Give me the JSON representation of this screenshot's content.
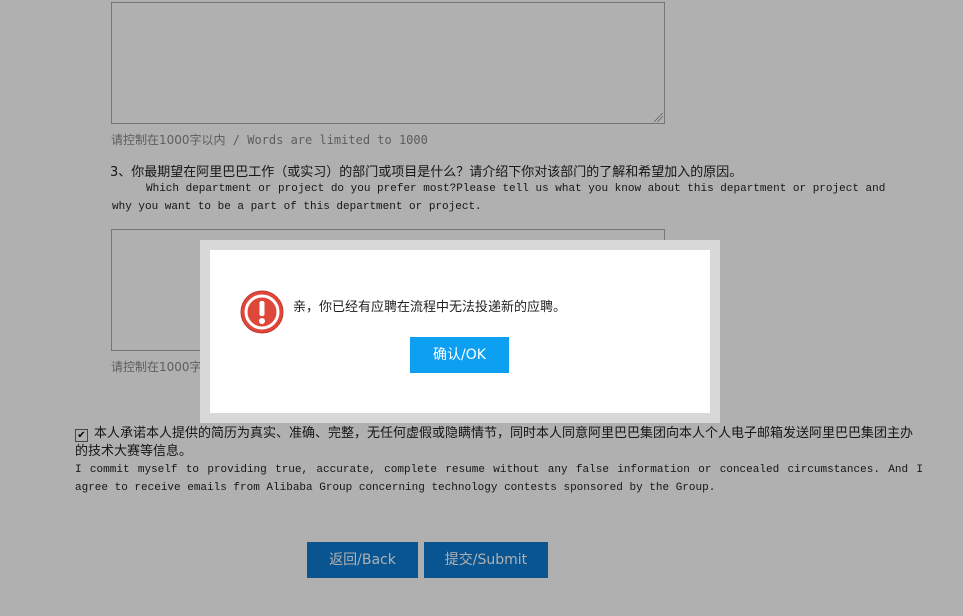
{
  "form": {
    "word_limit_hint_cn": "请控制在1000字以内",
    "word_limit_hint_en": " / Words are limited to 1000",
    "question3": {
      "title_cn": "3、你最期望在阿里巴巴工作（或实习）的部门或项目是什么？请介绍下你对该部门的了解和希望加入的原因。",
      "title_en": "Which department or project do you prefer most?Please tell us what you know about this department or project and why you want to be a part of this department or project."
    },
    "second_hint_cn": "请控制在1000字以",
    "commitment": {
      "checked_mark": "✔",
      "text_cn": "本人承诺本人提供的简历为真实、准确、完整，无任何虚假或隐瞒情节，同时本人同意阿里巴巴集团向本人个人电子邮箱发送阿里巴巴集团主办的技术大赛等信息。",
      "text_en": "I commit myself to providing true, accurate, complete resume without any false information or concealed circumstances. And I agree to receive emails from Alibaba Group concerning technology contests sponsored by the Group."
    },
    "back_label": "返回/Back",
    "submit_label": "提交/Submit"
  },
  "dialog": {
    "message": "亲，你已经有应聘在流程中无法投递新的应聘。",
    "ok_label": "确认/OK",
    "icon": "alert-exclamation-icon"
  },
  "colors": {
    "button_blue": "#0e7bd3",
    "ok_blue": "#0d9ff2",
    "alert_red": "#e0473b"
  }
}
